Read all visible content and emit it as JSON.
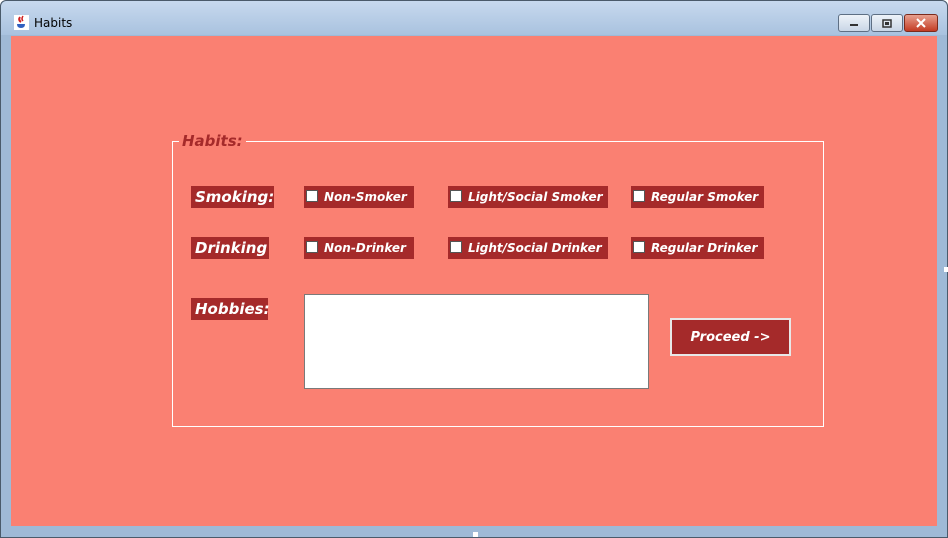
{
  "window": {
    "title": "Habits",
    "icon": "java-cup-icon",
    "controls": [
      "minimize",
      "maximize",
      "close"
    ]
  },
  "colors": {
    "background": "#fa8072",
    "label_fill": "#a52a2a",
    "label_text": "#ffffff",
    "legend_text": "#a52a2a",
    "border": "#ffffff"
  },
  "form": {
    "group_title": "Habits:",
    "smoking": {
      "label": "Smoking:",
      "options": [
        {
          "label": "Non-Smoker",
          "checked": false
        },
        {
          "label": "Light/Social Smoker",
          "checked": false
        },
        {
          "label": "Regular Smoker",
          "checked": false
        }
      ]
    },
    "drinking": {
      "label": "Drinking",
      "options": [
        {
          "label": "Non-Drinker",
          "checked": false
        },
        {
          "label": "Light/Social Drinker",
          "checked": false
        },
        {
          "label": "Regular Drinker",
          "checked": false
        }
      ]
    },
    "hobbies": {
      "label": "Hobbies:",
      "value": ""
    },
    "proceed_label": "Proceed ->"
  }
}
